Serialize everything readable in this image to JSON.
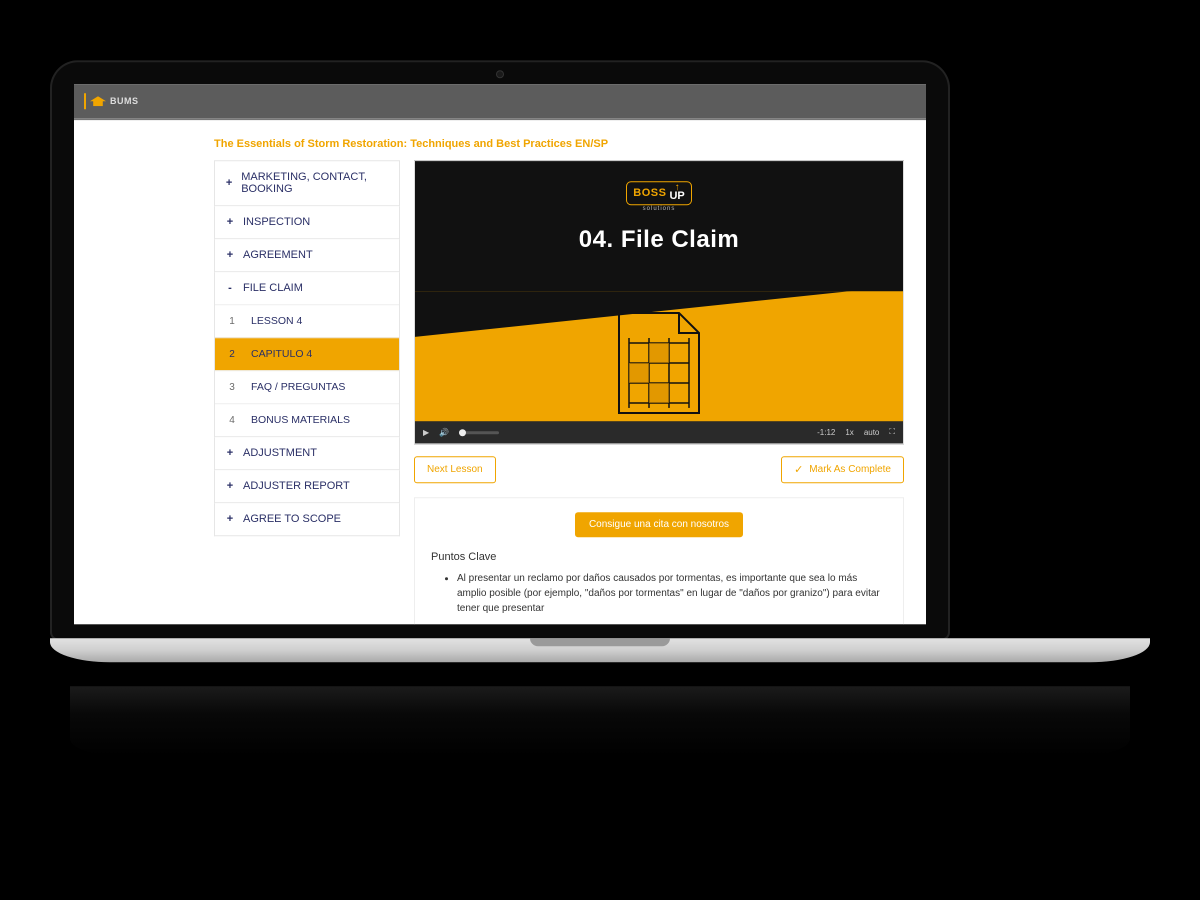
{
  "brand": {
    "text": "BUMS"
  },
  "course": {
    "title": "The Essentials of Storm Restoration: Techniques and Best Practices EN/SP"
  },
  "plus": "+",
  "minus": "-",
  "sidebar": {
    "items": [
      {
        "label": "MARKETING, CONTACT, BOOKING",
        "expanded": false
      },
      {
        "label": "INSPECTION",
        "expanded": false
      },
      {
        "label": "AGREEMENT",
        "expanded": false
      },
      {
        "label": "FILE CLAIM",
        "expanded": true,
        "lessons": [
          {
            "num": "1",
            "label": "LESSON 4"
          },
          {
            "num": "2",
            "label": "CAPITULO 4"
          },
          {
            "num": "3",
            "label": "FAQ / PREGUNTAS"
          },
          {
            "num": "4",
            "label": "BONUS MATERIALS"
          }
        ]
      },
      {
        "label": "ADJUSTMENT",
        "expanded": false
      },
      {
        "label": "ADJUSTER REPORT",
        "expanded": false
      },
      {
        "label": "AGREE TO SCOPE",
        "expanded": false
      }
    ]
  },
  "video": {
    "logo_main": "BOSS",
    "logo_up": "UP",
    "logo_sub": "solutions",
    "title": "04. File Claim",
    "time": "-1:12",
    "speed": "1x",
    "quality": "auto"
  },
  "actions": {
    "next": "Next Lesson",
    "complete": "Mark As Complete"
  },
  "cta": {
    "label": "Consigue una cita con nosotros"
  },
  "notes": {
    "heading": "Puntos Clave",
    "bullet1": "Al presentar un reclamo por daños causados por tormentas, es importante que sea lo más amplio posible (por ejemplo, \"daños por tormentas\" en lugar de \"daños por granizo\") para evitar tener que presentar"
  }
}
